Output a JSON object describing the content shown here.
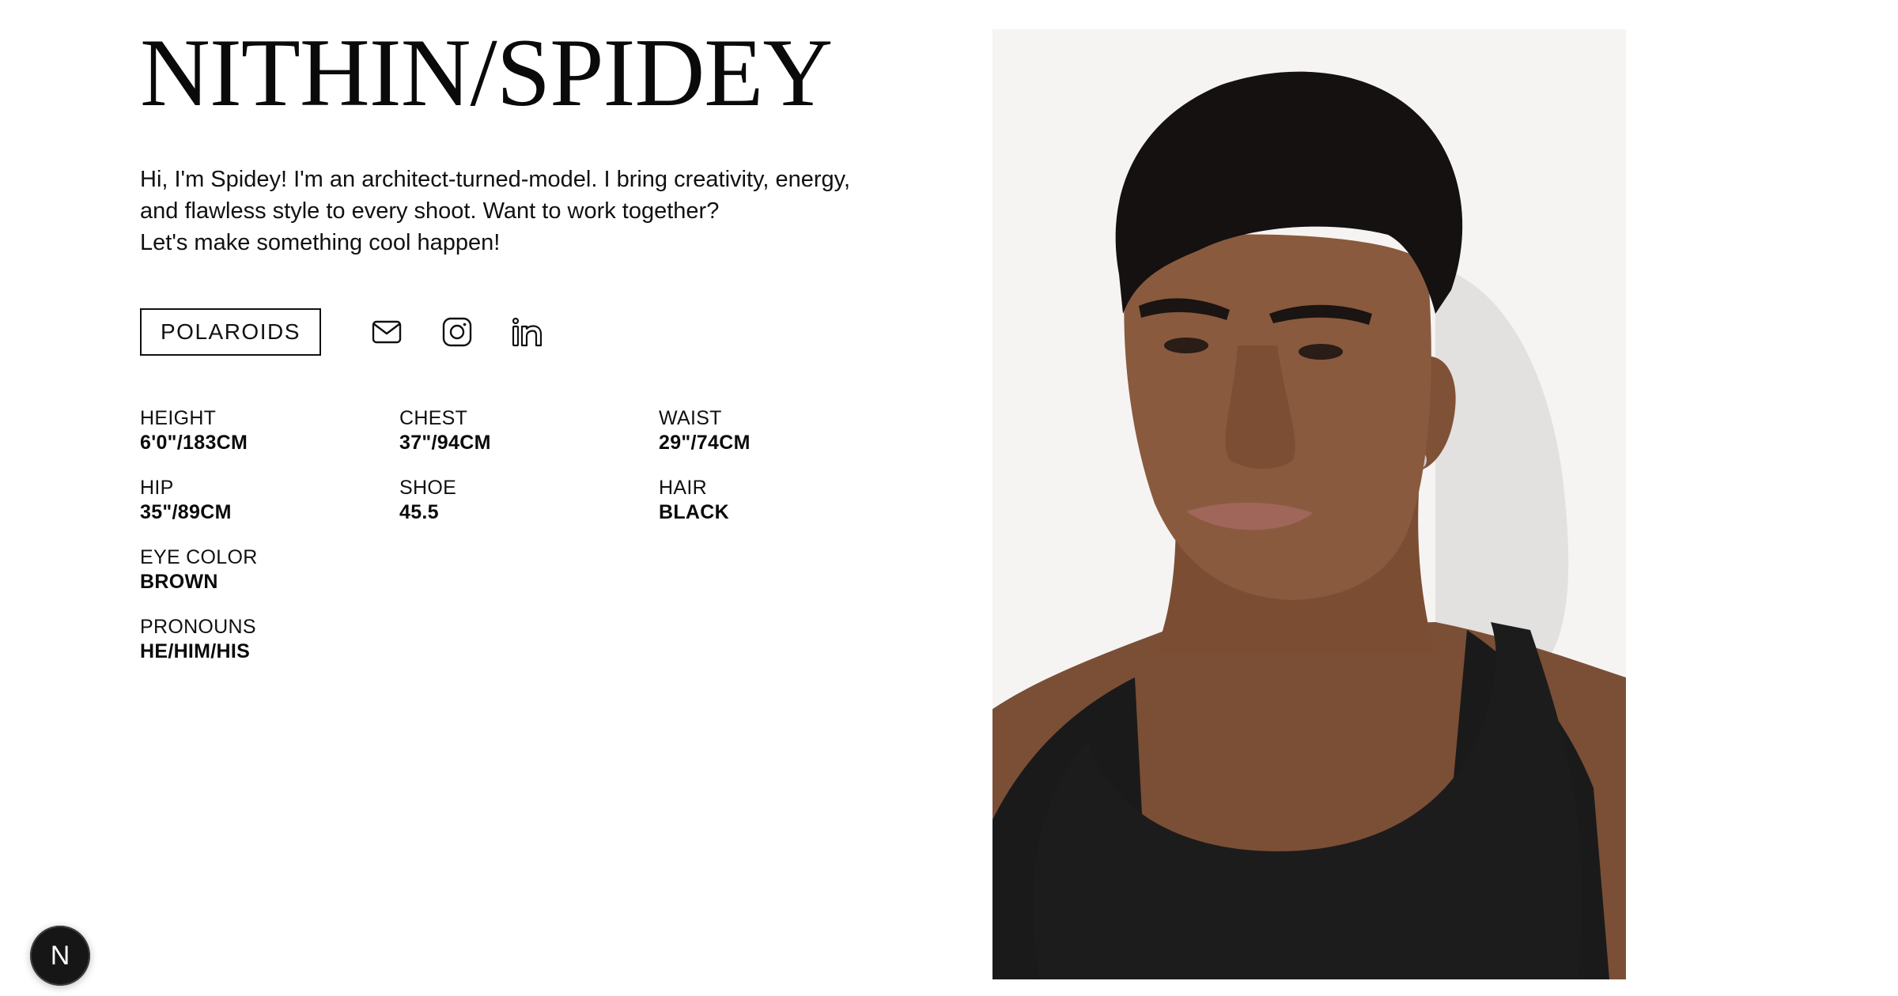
{
  "header": {
    "title": "NITHIN/SPIDEY"
  },
  "bio": {
    "line1": "Hi, I'm Spidey! I'm an architect-turned-model. I bring creativity, energy,",
    "line2": "and flawless style to every shoot. Want to work together?",
    "line3": "Let's make something cool happen!"
  },
  "actions": {
    "polaroids_label": "POLAROIDS",
    "icons": [
      "mail-icon",
      "instagram-icon",
      "linkedin-icon"
    ]
  },
  "stats": [
    {
      "label": "HEIGHT",
      "value": "6'0\"/183CM"
    },
    {
      "label": "CHEST",
      "value": "37\"/94CM"
    },
    {
      "label": "WAIST",
      "value": "29\"/74CM"
    },
    {
      "label": "HIP",
      "value": "35\"/89CM"
    },
    {
      "label": "SHOE",
      "value": "45.5"
    },
    {
      "label": "HAIR",
      "value": "BLACK"
    },
    {
      "label": "EYE COLOR",
      "value": "BROWN"
    },
    {
      "label": "PRONOUNS",
      "value": "HE/HIM/HIS"
    }
  ],
  "badge": {
    "letter": "N"
  },
  "colors": {
    "text": "#0d0d0d",
    "background": "#ffffff",
    "badge": "#161616"
  }
}
